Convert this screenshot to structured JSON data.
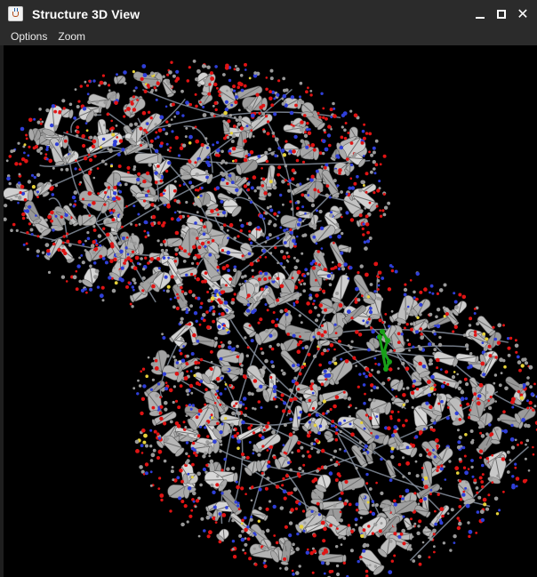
{
  "window": {
    "title": "Structure 3D View",
    "icon": "java-cup-icon",
    "controls": {
      "minimize": "minimize-icon",
      "maximize": "maximize-icon",
      "close": "close-icon",
      "close_glyph": "✕"
    }
  },
  "menubar": {
    "items": [
      {
        "label": "Options"
      },
      {
        "label": "Zoom"
      }
    ]
  },
  "viewer": {
    "background": "#000000",
    "cartoon_color": "#a9a9a9",
    "atom_colors": {
      "carbon": "#9a9a9a",
      "oxygen": "#e01414",
      "nitrogen": "#2f3fd8",
      "sulfur": "#e6d23a",
      "ligand": "#18a018"
    }
  }
}
